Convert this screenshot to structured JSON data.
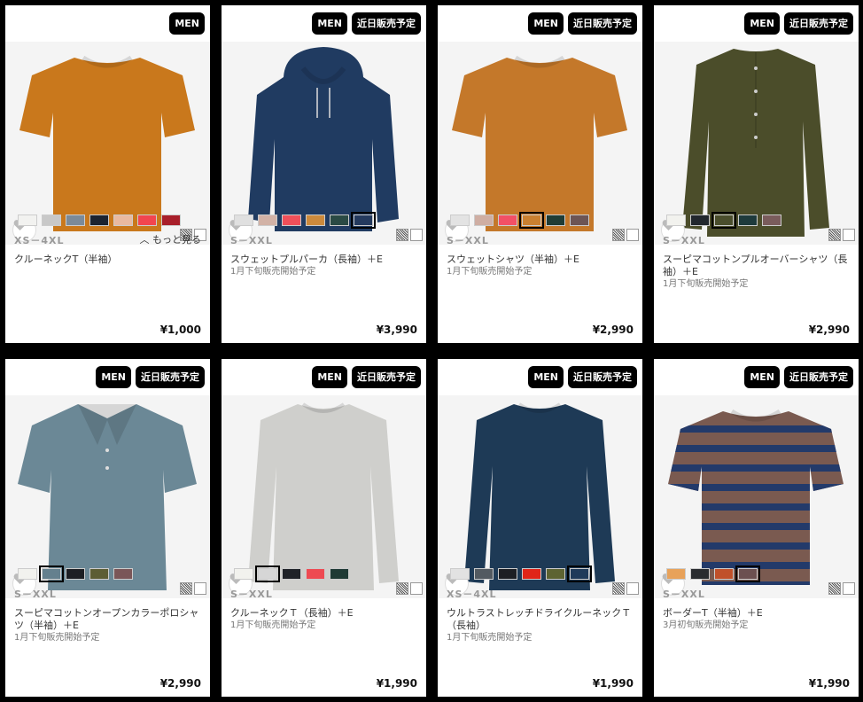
{
  "products": [
    {
      "badges": [
        "MEN"
      ],
      "colors": [
        "#f2f2f0",
        "#c8c8c8",
        "#7b8a99",
        "#1c2330",
        "#e9b9a0",
        "#f2454f",
        "#a81f2a"
      ],
      "selected": -1,
      "size": "XS－4XL",
      "more": "もっと見る",
      "name": "クルーネックT（半袖）",
      "note": "",
      "price": "¥1,000",
      "img": {
        "shape": "tee",
        "color": "#c9781c"
      }
    },
    {
      "badges": [
        "MEN",
        "近日販売予定"
      ],
      "colors": [
        "#e0e0e0",
        "#d2b2a6",
        "#f0505a",
        "#cc8a3c",
        "#2a4a44",
        "#243a5e"
      ],
      "selected": 5,
      "size": "S－XXL",
      "more": "",
      "name": "スウェットプルパーカ（長袖）＋E",
      "note": "1月下旬販売開始予定",
      "price": "¥3,990",
      "img": {
        "shape": "hoodie",
        "color": "#203b61"
      }
    },
    {
      "badges": [
        "MEN",
        "近日販売予定"
      ],
      "colors": [
        "#e3e3e3",
        "#cfaea3",
        "#f25065",
        "#c98030",
        "#1f3c35",
        "#6c5555"
      ],
      "selected": 3,
      "size": "S－XXL",
      "more": "",
      "name": "スウェットシャツ（半袖）＋E",
      "note": "1月下旬販売開始予定",
      "price": "¥2,990",
      "img": {
        "shape": "tee",
        "color": "#c4782a"
      }
    },
    {
      "badges": [
        "MEN",
        "近日販売予定"
      ],
      "colors": [
        "#f2f2ee",
        "#22272e",
        "#4a4e2c",
        "#1e3a3c",
        "#7a5c5c"
      ],
      "selected": 2,
      "size": "S－XXL",
      "more": "",
      "name": "スーピマコットンプルオーバーシャツ（長袖）＋E",
      "note": "1月下旬販売開始予定",
      "price": "¥2,990",
      "img": {
        "shape": "henley",
        "color": "#4b4d2a"
      }
    },
    {
      "badges": [
        "MEN",
        "近日販売予定"
      ],
      "colors": [
        "#f2f2ee",
        "#64808e",
        "#1d1f24",
        "#5c5d34",
        "#7a5658"
      ],
      "selected": 1,
      "size": "S－XXL",
      "more": "",
      "name": "スーピマコットンオープンカラーポロシャツ（半袖）＋E",
      "note": "1月下旬販売開始予定",
      "price": "¥2,990",
      "img": {
        "shape": "polo",
        "color": "#6b8896"
      }
    },
    {
      "badges": [
        "MEN",
        "近日販売予定"
      ],
      "colors": [
        "#f2f2ee",
        "#d6d6d6",
        "#1f2228",
        "#ee4a52",
        "#1f3a35"
      ],
      "selected": 1,
      "size": "S－XXL",
      "more": "",
      "name": "クルーネックＴ（長袖）＋E",
      "note": "1月下旬販売開始予定",
      "price": "¥1,990",
      "img": {
        "shape": "longtee",
        "color": "#cfcfcc"
      }
    },
    {
      "badges": [
        "MEN",
        "近日販売予定"
      ],
      "colors": [
        "#e2e2e2",
        "#535a61",
        "#1d1f24",
        "#e02418",
        "#5d6332",
        "#1e3a5a"
      ],
      "selected": 5,
      "size": "XS－4XL",
      "more": "",
      "name": "ウルトラストレッチドライクルーネックＴ（長袖）",
      "note": "1月下旬販売開始予定",
      "price": "¥1,990",
      "img": {
        "shape": "longtee",
        "color": "#1e3a56"
      }
    },
    {
      "badges": [
        "MEN",
        "近日販売予定"
      ],
      "colors": [
        "#e8a25a",
        "#2a2c30",
        "#c0502a",
        "#6c5050"
      ],
      "selected": 3,
      "size": "S－XXL",
      "more": "",
      "name": "ボーダーT（半袖）＋E",
      "note": "3月初旬販売開始予定",
      "price": "¥1,990",
      "img": {
        "shape": "stripe",
        "color": "#7a5a50",
        "stripe": "#233a6a"
      }
    }
  ]
}
